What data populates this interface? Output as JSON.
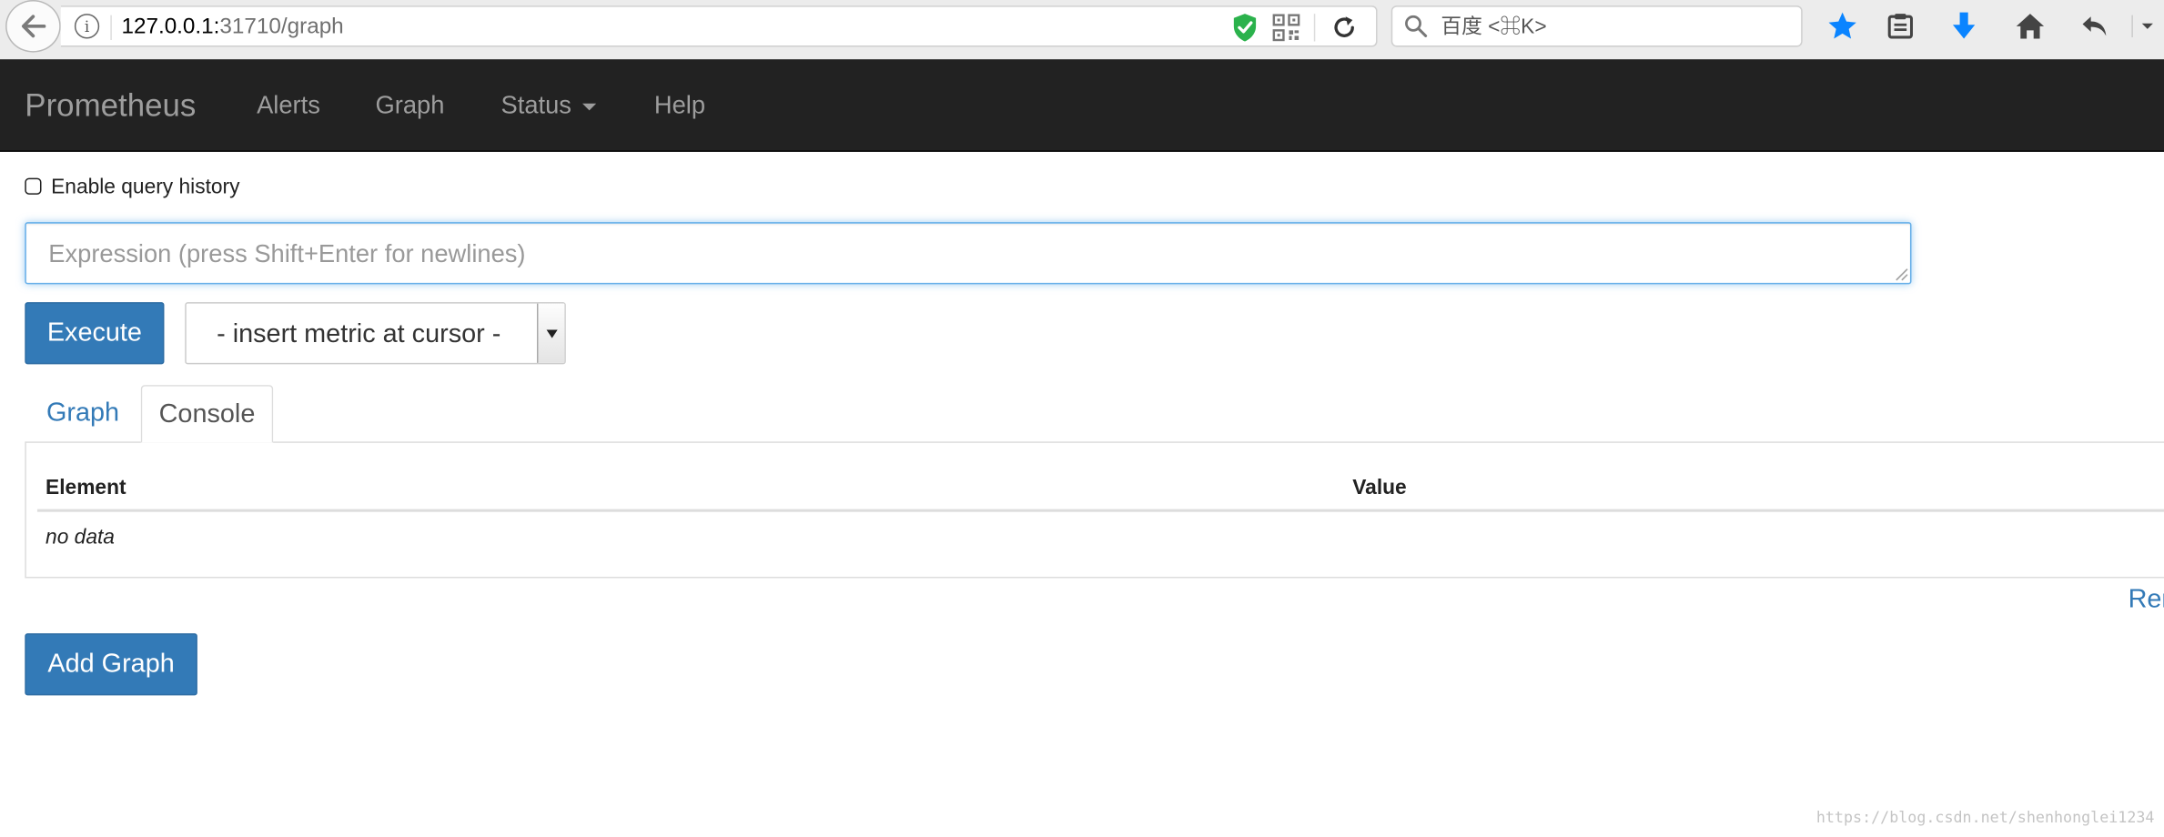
{
  "browser": {
    "url_host": "127.0.0.1:",
    "url_rest": "31710/graph",
    "search_placeholder": "百度 <⌘K>",
    "icons": [
      "back-arrow-icon",
      "info-icon",
      "shield-check-icon",
      "qr-code-icon",
      "reload-icon",
      "search-icon",
      "bookmark-star-icon",
      "reading-list-icon",
      "download-icon",
      "home-icon",
      "undo-icon",
      "menu-chevron-icon"
    ]
  },
  "navbar": {
    "brand": "Prometheus",
    "links": {
      "alerts": "Alerts",
      "graph": "Graph",
      "status": "Status",
      "help": "Help"
    }
  },
  "query": {
    "history_label": "Enable query history",
    "history_checked": false,
    "expression_placeholder": "Expression (press Shift+Enter for newlines)",
    "execute_label": "Execute",
    "metric_select_value": "- insert metric at cursor -"
  },
  "tabs": {
    "graph": "Graph",
    "console": "Console",
    "active": "Console"
  },
  "table": {
    "columns": [
      "Element",
      "Value"
    ],
    "empty_text": "no data"
  },
  "actions": {
    "remove_graph_label": "Ren",
    "add_graph_label": "Add Graph"
  },
  "watermark": "https://blog.csdn.net/shenhonglei1234",
  "colors": {
    "navbar_bg": "#222222",
    "navbar_text": "#9d9d9d",
    "primary": "#337ab7",
    "focus_border": "#66afe9"
  }
}
